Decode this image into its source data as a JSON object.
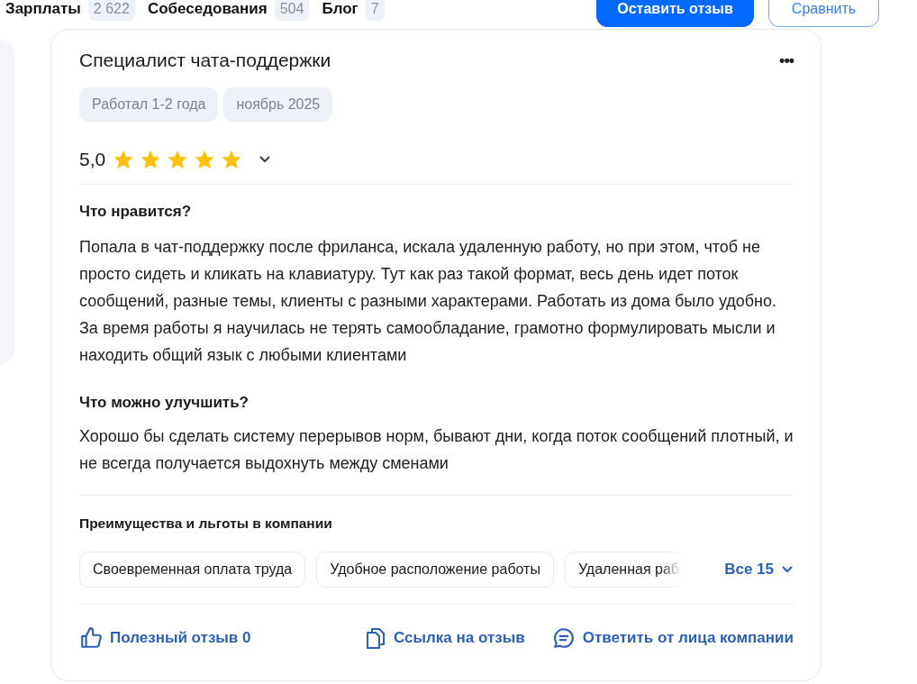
{
  "nav": {
    "items": [
      {
        "label": "Зарплаты",
        "count": "2 622"
      },
      {
        "label": "Собеседования",
        "count": "504"
      },
      {
        "label": "Блог",
        "count": "7"
      }
    ],
    "buttons": [
      {
        "label": "Оставить отзыв",
        "kind": "primary"
      },
      {
        "label": "Сравнить",
        "kind": "outline"
      }
    ]
  },
  "review": {
    "title": "Специалист чата-поддержки",
    "menu": "•••",
    "tags": [
      "Работал 1-2 года",
      "ноябрь 2025"
    ],
    "rating": "5,0",
    "stars": 5,
    "sections": [
      {
        "heading": "Что нравится?",
        "text": "Попала в чат-поддержку после фриланса, искала удаленную работу, но при этом, чтоб не просто сидеть и кликать на клавиатуру. Тут как раз такой формат, весь день идет поток сообщений, разные темы, клиенты с разными характерами. Работать из дома было удобно. За время работы я научилась не терять самообладание, грамотно формулировать мысли и находить общий язык с любыми клиентами"
      },
      {
        "heading": "Что можно улучшить?",
        "text": "Хорошо бы сделать систему перерывов норм, бывают дни, когда поток сообщений плотный, и не всегда получается выдохнуть между сменами"
      }
    ],
    "benefits": {
      "heading": "Преимущества и льготы в компании",
      "items": [
        "Своевременная оплата труда",
        "Удобное расположение работы",
        "Удаленная раб"
      ],
      "more": "Все 15"
    },
    "actions": [
      {
        "label": "Полезный отзыв 0",
        "kind": "like"
      },
      {
        "label": "Ссылка на отзыв",
        "kind": "copy"
      },
      {
        "label": "Ответить от лица компании",
        "kind": "reply"
      }
    ]
  }
}
